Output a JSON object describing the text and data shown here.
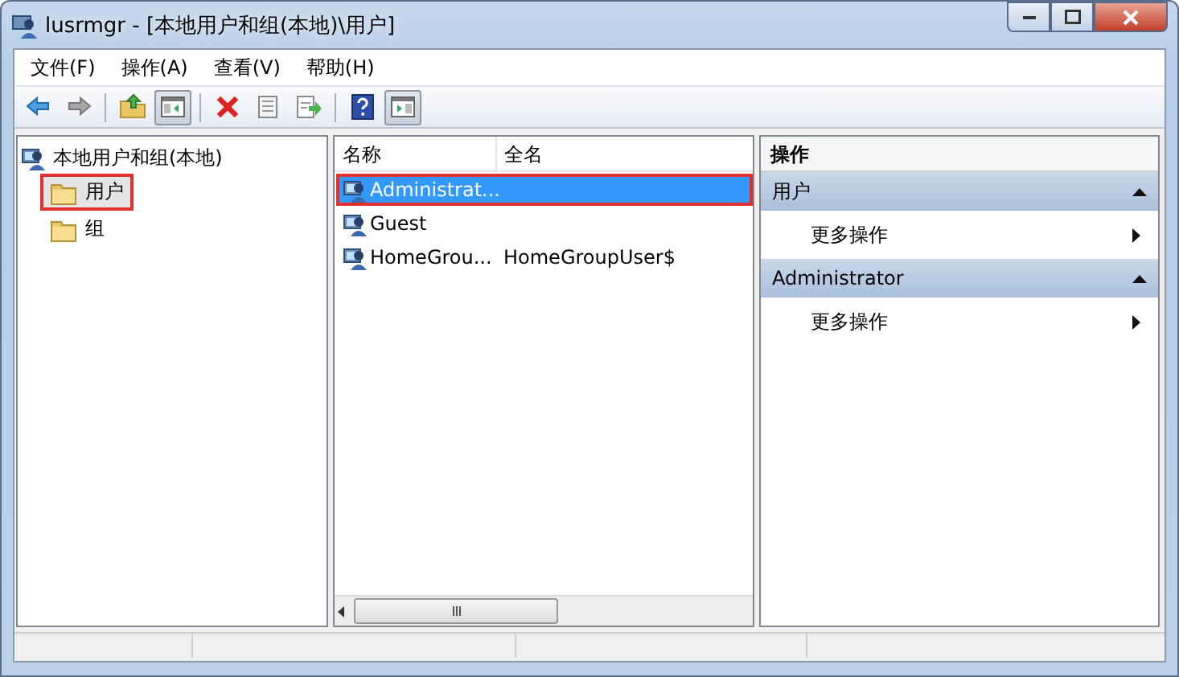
{
  "window": {
    "title": "lusrmgr - [本地用户和组(本地)\\用户]"
  },
  "menu": [
    "文件(F)",
    "操作(A)",
    "查看(V)",
    "帮助(H)"
  ],
  "toolbar": [
    {
      "kind": "back"
    },
    {
      "kind": "forward"
    },
    {
      "kind": "separator"
    },
    {
      "kind": "up"
    },
    {
      "kind": "tree-toggle",
      "pressed": true
    },
    {
      "kind": "separator"
    },
    {
      "kind": "delete"
    },
    {
      "kind": "properties"
    },
    {
      "kind": "export"
    },
    {
      "kind": "separator"
    },
    {
      "kind": "help"
    },
    {
      "kind": "action-toggle",
      "pressed": true
    }
  ],
  "tree": {
    "label": "本地用户和组(本地)",
    "children": [
      {
        "label": "用户",
        "selected": true,
        "highlighted": true
      },
      {
        "label": "组",
        "selected": false,
        "highlighted": false
      }
    ]
  },
  "list": {
    "columns": [
      "名称",
      "全名"
    ],
    "rows": [
      {
        "cells": [
          "Administrat..."
        ],
        "selected": true,
        "highlighted": true
      },
      {
        "cells": [
          "Guest"
        ],
        "selected": false,
        "highlighted": false
      },
      {
        "cells": [
          "HomeGrou...",
          "HomeGroupUser$"
        ],
        "selected": false,
        "highlighted": false
      }
    ]
  },
  "actions": {
    "title": "操作",
    "sections": [
      {
        "title": "用户",
        "expanded": true,
        "items": [
          "更多操作"
        ]
      },
      {
        "title": "Administrator",
        "expanded": true,
        "items": [
          "更多操作"
        ]
      }
    ]
  }
}
